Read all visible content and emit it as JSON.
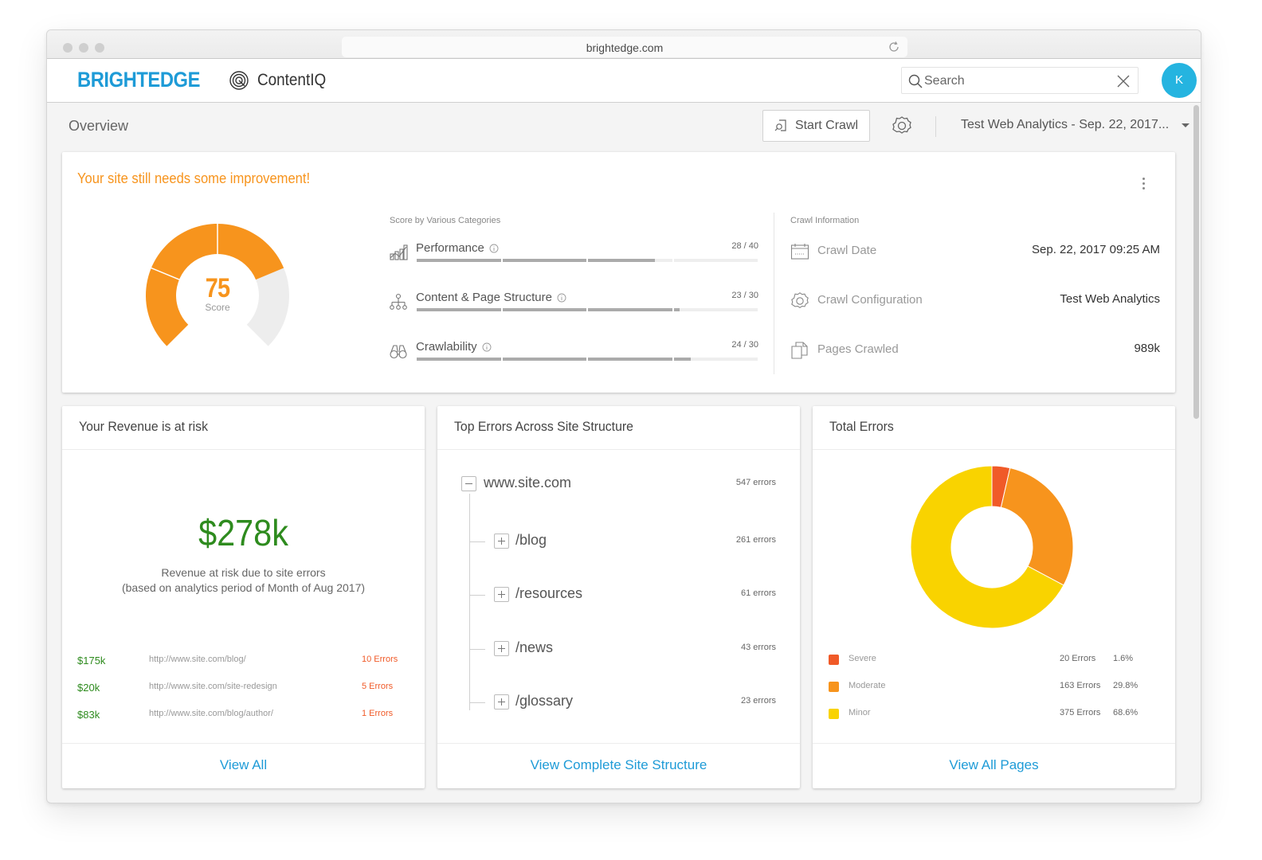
{
  "browser": {
    "url": "brightedge.com"
  },
  "header": {
    "logo": "BRIGHTEDGE",
    "product_name": "ContentIQ",
    "search_placeholder": "Search",
    "avatar_initial": "K",
    "brand_color": "#1e9bd7",
    "avatar_color": "#25b4e0"
  },
  "subheader": {
    "title": "Overview",
    "start_crawl_label": "Start Crawl",
    "analytics_selected": "Test Web Analytics - Sep. 22, 2017..."
  },
  "score_card": {
    "headline": "Your site still needs some improvement!",
    "score": "75",
    "score_label": "Score",
    "score_value": 75,
    "score_max": 100,
    "accent_color": "#f7941d",
    "categories_title": "Score by Various Categories",
    "categories": [
      {
        "label": "Performance",
        "icon": "performance-chart-icon",
        "score_text": "28 / 40",
        "value": 28,
        "max": 40
      },
      {
        "label": "Content & Page Structure",
        "icon": "sitemap-icon",
        "score_text": "23 / 30",
        "value": 23,
        "max": 30
      },
      {
        "label": "Crawlability",
        "icon": "binoculars-icon",
        "score_text": "24 / 30",
        "value": 24,
        "max": 30
      }
    ],
    "crawl_info_title": "Crawl Information",
    "crawl_info": [
      {
        "label": "Crawl Date",
        "icon": "calendar-icon",
        "value": "Sep. 22, 2017 09:25 AM"
      },
      {
        "label": "Crawl Configuration",
        "icon": "gear-icon",
        "value": "Test Web Analytics"
      },
      {
        "label": "Pages Crawled",
        "icon": "pages-icon",
        "value": "989k"
      }
    ]
  },
  "revenue_panel": {
    "title": "Your Revenue is at risk",
    "amount": "$278k",
    "description_line1": "Revenue at risk due to site errors",
    "description_line2": "(based on analytics period of Month of Aug 2017)",
    "rows": [
      {
        "amount": "$175k",
        "url": "http://www.site.com/blog/",
        "errors": "10 Errors"
      },
      {
        "amount": "$20k",
        "url": "http://www.site.com/site-redesign",
        "errors": "5 Errors"
      },
      {
        "amount": "$83k",
        "url": "http://www.site.com/blog/author/",
        "errors": "1 Errors"
      }
    ],
    "link_label": "View All",
    "positive_color": "#2e8b1e",
    "error_color": "#f05a28"
  },
  "tree_panel": {
    "title": "Top Errors Across Site Structure",
    "root": {
      "label": "www.site.com",
      "count": "547 errors",
      "expanded": true
    },
    "children": [
      {
        "label": "/blog",
        "count": "261 errors"
      },
      {
        "label": "/resources",
        "count": "61 errors"
      },
      {
        "label": "/news",
        "count": "43 errors"
      },
      {
        "label": "/glossary",
        "count": "23 errors"
      }
    ],
    "link_label": "View Complete Site Structure"
  },
  "errors_panel": {
    "title": "Total Errors",
    "legend": [
      {
        "label": "Severe",
        "count": "20 Errors",
        "pct": "1.6%",
        "value": 20,
        "color": "#f05a28"
      },
      {
        "label": "Moderate",
        "count": "163 Errors",
        "pct": "29.8%",
        "value": 163,
        "color": "#f7941d"
      },
      {
        "label": "Minor",
        "count": "375 Errors",
        "pct": "68.6%",
        "value": 375,
        "color": "#f9d300"
      }
    ],
    "link_label": "View All Pages"
  }
}
